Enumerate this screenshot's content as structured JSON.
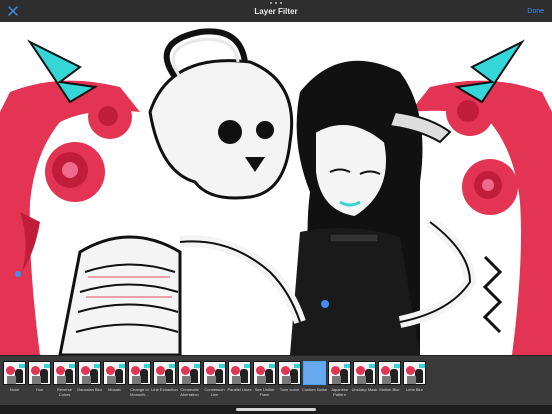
{
  "header": {
    "title": "Layer Filter",
    "done_label": "Done",
    "close_icon": "close-icon"
  },
  "colors": {
    "accent": "#3e8ef0",
    "toolbar_bg": "#2e2e2e",
    "strip_bg": "#3a3a3a",
    "art_red": "#e33553",
    "art_cyan": "#34d6d8",
    "art_pink": "#f06a8c"
  },
  "canvas": {
    "description_icon": "illustration-artwork"
  },
  "filters": {
    "selected": "Custom Noise",
    "items": [
      {
        "label": "None"
      },
      {
        "label": "Hue"
      },
      {
        "label": "Reverse Colors"
      },
      {
        "label": "Gaussian Blur"
      },
      {
        "label": "Mosaic"
      },
      {
        "label": "Change to Monochr..."
      },
      {
        "label": "Line Extraction"
      },
      {
        "label": "Chromatic Aberration"
      },
      {
        "label": "Conversion Line"
      },
      {
        "label": "Parallel Lines"
      },
      {
        "label": "See Unfilm Flash"
      },
      {
        "label": "Tone curve"
      },
      {
        "label": "Custom Noise"
      },
      {
        "label": "Japanese Pattern"
      },
      {
        "label": "Unsharp Mask"
      },
      {
        "label": "Motion Blur"
      },
      {
        "label": "Lens Blur"
      }
    ]
  }
}
